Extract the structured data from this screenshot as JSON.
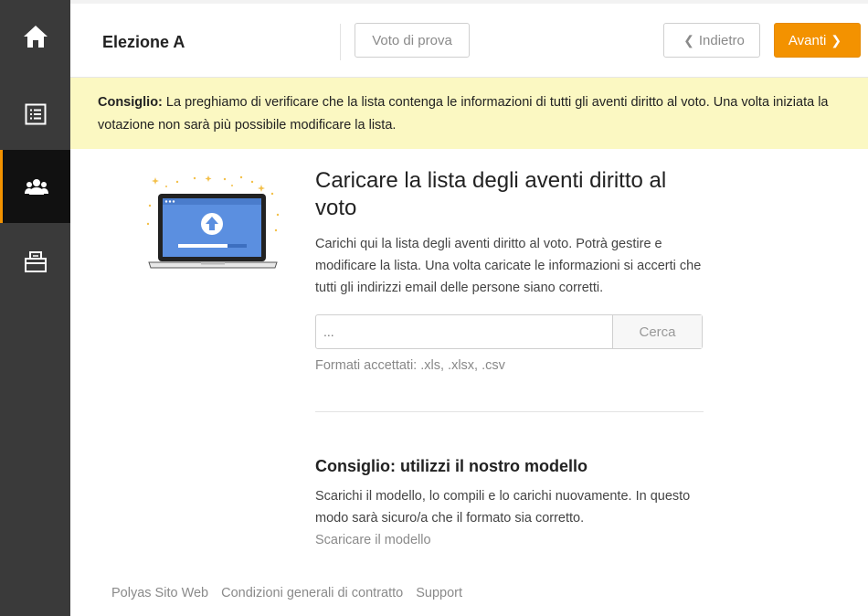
{
  "sidebar": {
    "items": [
      {
        "icon": "home-icon"
      },
      {
        "icon": "list-icon"
      },
      {
        "icon": "voters-icon"
      },
      {
        "icon": "ballot-box-icon"
      }
    ]
  },
  "header": {
    "title": "Elezione A",
    "test_vote_label": "Voto di prova",
    "back_label": "Indietro",
    "next_label": "Avanti"
  },
  "hint": {
    "label": "Consiglio:",
    "text": " La preghiamo di verificare che la lista contenga le informazioni di tutti gli aventi diritto al voto. Una volta iniziata la votazione non sarà più possibile modificare la lista."
  },
  "main": {
    "heading": "Caricare la lista degli aventi diritto al voto",
    "description": "Carichi qui la lista degli aventi diritto al voto. Potrà gestire e modificare la lista. Una volta caricate le informazioni si accerti che tutti gli indirizzi email delle persone siano corretti.",
    "upload_placeholder": "...",
    "browse_label": "Cerca",
    "formats": "Formati accettati: .xls, .xlsx, .csv",
    "template_heading": "Consiglio: utilizzi il nostro modello",
    "template_description": "Scarichi il modello, lo compili e lo carichi nuovamente. In questo modo sarà sicuro/a che il formato sia corretto.",
    "template_link": "Scaricare il modello"
  },
  "footer": {
    "links": [
      "Polyas Sito Web",
      "Condizioni generali di contratto",
      "Support"
    ]
  },
  "colors": {
    "accent": "#f39200",
    "sidebar": "#3a3a3a",
    "hint_bg": "#fbf8c2"
  }
}
